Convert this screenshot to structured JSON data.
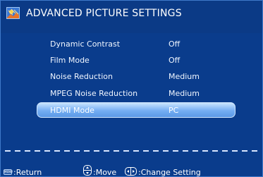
{
  "header": {
    "title": "ADVANCED PICTURE SETTINGS",
    "icon": "picture-settings-icon"
  },
  "menu": {
    "items": [
      {
        "label": "Dynamic Contrast",
        "value": "Off",
        "selected": false
      },
      {
        "label": "Film Mode",
        "value": "Off",
        "selected": false
      },
      {
        "label": "Noise Reduction",
        "value": "Medium",
        "selected": false
      },
      {
        "label": "MPEG Noise Reduction",
        "value": "Medium",
        "selected": false
      },
      {
        "label": "HDMI Mode",
        "value": "PC",
        "selected": true
      }
    ]
  },
  "footer": {
    "menu_key_label": "MENU",
    "return_label": ":Return",
    "move_label": ":Move",
    "change_label": ":Change Setting"
  },
  "colors": {
    "panel_background": "#0a3c8c",
    "highlight": "#74aef3",
    "text": "#ffffff"
  }
}
